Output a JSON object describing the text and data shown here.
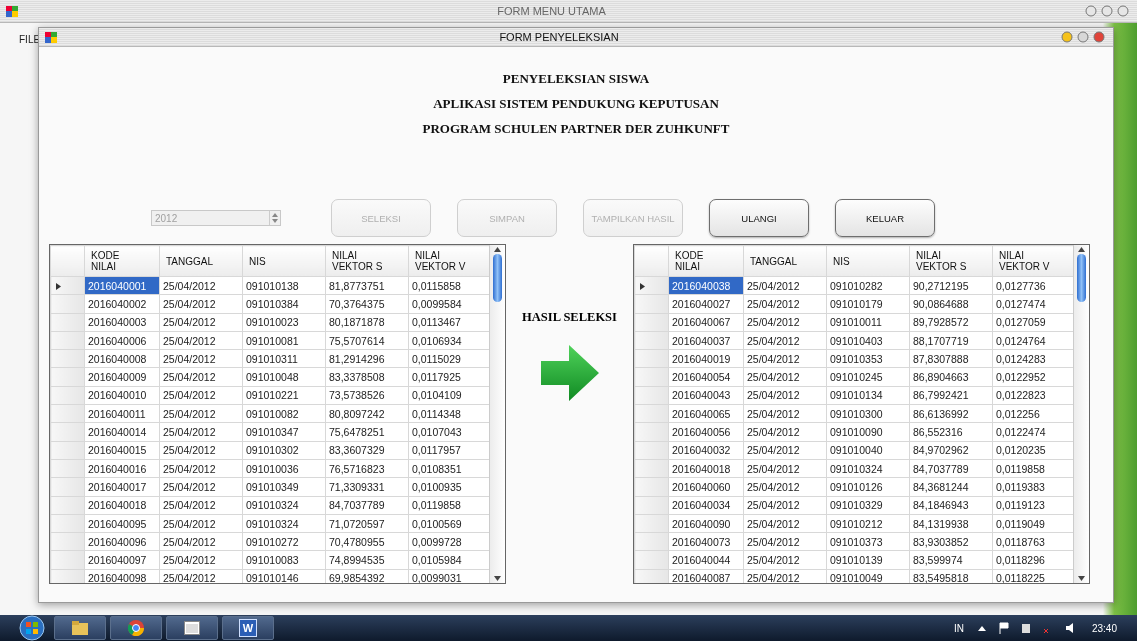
{
  "main_window": {
    "title": "FORM MENU UTAMA",
    "menu": [
      "FILE"
    ]
  },
  "dialog": {
    "title": "FORM PENYELEKSIAN",
    "headings": [
      "PENYELEKSIAN SISWA",
      "APLIKASI SISTEM PENDUKUNG KEPUTUSAN",
      "PROGRAM SCHULEN PARTNER DER ZUHKUNFT"
    ],
    "year_select": {
      "value": "2012",
      "disabled": true
    },
    "buttons": [
      {
        "label": "SELEKSI",
        "disabled": true
      },
      {
        "label": "SIMPAN",
        "disabled": true
      },
      {
        "label": "TAMPILKAN HASIL",
        "disabled": true
      },
      {
        "label": "ULANGI",
        "disabled": false
      },
      {
        "label": "KELUAR",
        "disabled": false
      }
    ],
    "result_label": "HASIL SELEKSI",
    "tables": [
      {
        "columns": [
          "KODE\nNILAI",
          "TANGGAL",
          "NIS",
          "NILAI\nVEKTOR S",
          "NILAI\nVEKTOR V"
        ],
        "rows": [
          {
            "selected": true,
            "cells": [
              "2016040001",
              "25/04/2012",
              "091010138",
              "81,8773751",
              "0,0115858"
            ]
          },
          {
            "selected": false,
            "cells": [
              "2016040002",
              "25/04/2012",
              "091010384",
              "70,3764375",
              "0,0099584"
            ]
          },
          {
            "selected": false,
            "cells": [
              "2016040003",
              "25/04/2012",
              "091010023",
              "80,1871878",
              "0,0113467"
            ]
          },
          {
            "selected": false,
            "cells": [
              "2016040006",
              "25/04/2012",
              "091010081",
              "75,5707614",
              "0,0106934"
            ]
          },
          {
            "selected": false,
            "cells": [
              "2016040008",
              "25/04/2012",
              "091010311",
              "81,2914296",
              "0,0115029"
            ]
          },
          {
            "selected": false,
            "cells": [
              "2016040009",
              "25/04/2012",
              "091010048",
              "83,3378508",
              "0,0117925"
            ]
          },
          {
            "selected": false,
            "cells": [
              "2016040010",
              "25/04/2012",
              "091010221",
              "73,5738526",
              "0,0104109"
            ]
          },
          {
            "selected": false,
            "cells": [
              "2016040011",
              "25/04/2012",
              "091010082",
              "80,8097242",
              "0,0114348"
            ]
          },
          {
            "selected": false,
            "cells": [
              "2016040014",
              "25/04/2012",
              "091010347",
              "75,6478251",
              "0,0107043"
            ]
          },
          {
            "selected": false,
            "cells": [
              "2016040015",
              "25/04/2012",
              "091010302",
              "83,3607329",
              "0,0117957"
            ]
          },
          {
            "selected": false,
            "cells": [
              "2016040016",
              "25/04/2012",
              "091010036",
              "76,5716823",
              "0,0108351"
            ]
          },
          {
            "selected": false,
            "cells": [
              "2016040017",
              "25/04/2012",
              "091010349",
              "71,3309331",
              "0,0100935"
            ]
          },
          {
            "selected": false,
            "cells": [
              "2016040018",
              "25/04/2012",
              "091010324",
              "84,7037789",
              "0,0119858"
            ]
          },
          {
            "selected": false,
            "cells": [
              "2016040095",
              "25/04/2012",
              "091010324",
              "71,0720597",
              "0,0100569"
            ]
          },
          {
            "selected": false,
            "cells": [
              "2016040096",
              "25/04/2012",
              "091010272",
              "70,4780955",
              "0,0099728"
            ]
          },
          {
            "selected": false,
            "cells": [
              "2016040097",
              "25/04/2012",
              "091010083",
              "74,8994535",
              "0,0105984"
            ]
          },
          {
            "selected": false,
            "cells": [
              "2016040098",
              "25/04/2012",
              "091010146",
              "69,9854392",
              "0,0099031"
            ]
          }
        ]
      },
      {
        "columns": [
          "KODE\nNILAI",
          "TANGGAL",
          "NIS",
          "NILAI\nVEKTOR S",
          "NILAI\nVEKTOR V"
        ],
        "rows": [
          {
            "selected": true,
            "cells": [
              "2016040038",
              "25/04/2012",
              "091010282",
              "90,2712195",
              "0,0127736"
            ]
          },
          {
            "selected": false,
            "cells": [
              "2016040027",
              "25/04/2012",
              "091010179",
              "90,0864688",
              "0,0127474"
            ]
          },
          {
            "selected": false,
            "cells": [
              "2016040067",
              "25/04/2012",
              "091010011",
              "89,7928572",
              "0,0127059"
            ]
          },
          {
            "selected": false,
            "cells": [
              "2016040037",
              "25/04/2012",
              "091010403",
              "88,1707719",
              "0,0124764"
            ]
          },
          {
            "selected": false,
            "cells": [
              "2016040019",
              "25/04/2012",
              "091010353",
              "87,8307888",
              "0,0124283"
            ]
          },
          {
            "selected": false,
            "cells": [
              "2016040054",
              "25/04/2012",
              "091010245",
              "86,8904663",
              "0,0122952"
            ]
          },
          {
            "selected": false,
            "cells": [
              "2016040043",
              "25/04/2012",
              "091010134",
              "86,7992421",
              "0,0122823"
            ]
          },
          {
            "selected": false,
            "cells": [
              "2016040065",
              "25/04/2012",
              "091010300",
              "86,6136992",
              "0,012256"
            ]
          },
          {
            "selected": false,
            "cells": [
              "2016040056",
              "25/04/2012",
              "091010090",
              "86,552316",
              "0,0122474"
            ]
          },
          {
            "selected": false,
            "cells": [
              "2016040032",
              "25/04/2012",
              "091010040",
              "84,9702962",
              "0,0120235"
            ]
          },
          {
            "selected": false,
            "cells": [
              "2016040018",
              "25/04/2012",
              "091010324",
              "84,7037789",
              "0,0119858"
            ]
          },
          {
            "selected": false,
            "cells": [
              "2016040060",
              "25/04/2012",
              "091010126",
              "84,3681244",
              "0,0119383"
            ]
          },
          {
            "selected": false,
            "cells": [
              "2016040034",
              "25/04/2012",
              "091010329",
              "84,1846943",
              "0,0119123"
            ]
          },
          {
            "selected": false,
            "cells": [
              "2016040090",
              "25/04/2012",
              "091010212",
              "84,1319938",
              "0,0119049"
            ]
          },
          {
            "selected": false,
            "cells": [
              "2016040073",
              "25/04/2012",
              "091010373",
              "83,9303852",
              "0,0118763"
            ]
          },
          {
            "selected": false,
            "cells": [
              "2016040044",
              "25/04/2012",
              "091010139",
              "83,599974",
              "0,0118296"
            ]
          },
          {
            "selected": false,
            "cells": [
              "2016040087",
              "25/04/2012",
              "091010049",
              "83,5495818",
              "0,0118225"
            ]
          }
        ]
      }
    ]
  },
  "taskbar": {
    "apps": [
      {
        "kind": "folder"
      },
      {
        "kind": "browser"
      },
      {
        "kind": "window"
      },
      {
        "kind": "word",
        "label": "W"
      }
    ],
    "language": "IN",
    "clock": "23:40"
  }
}
